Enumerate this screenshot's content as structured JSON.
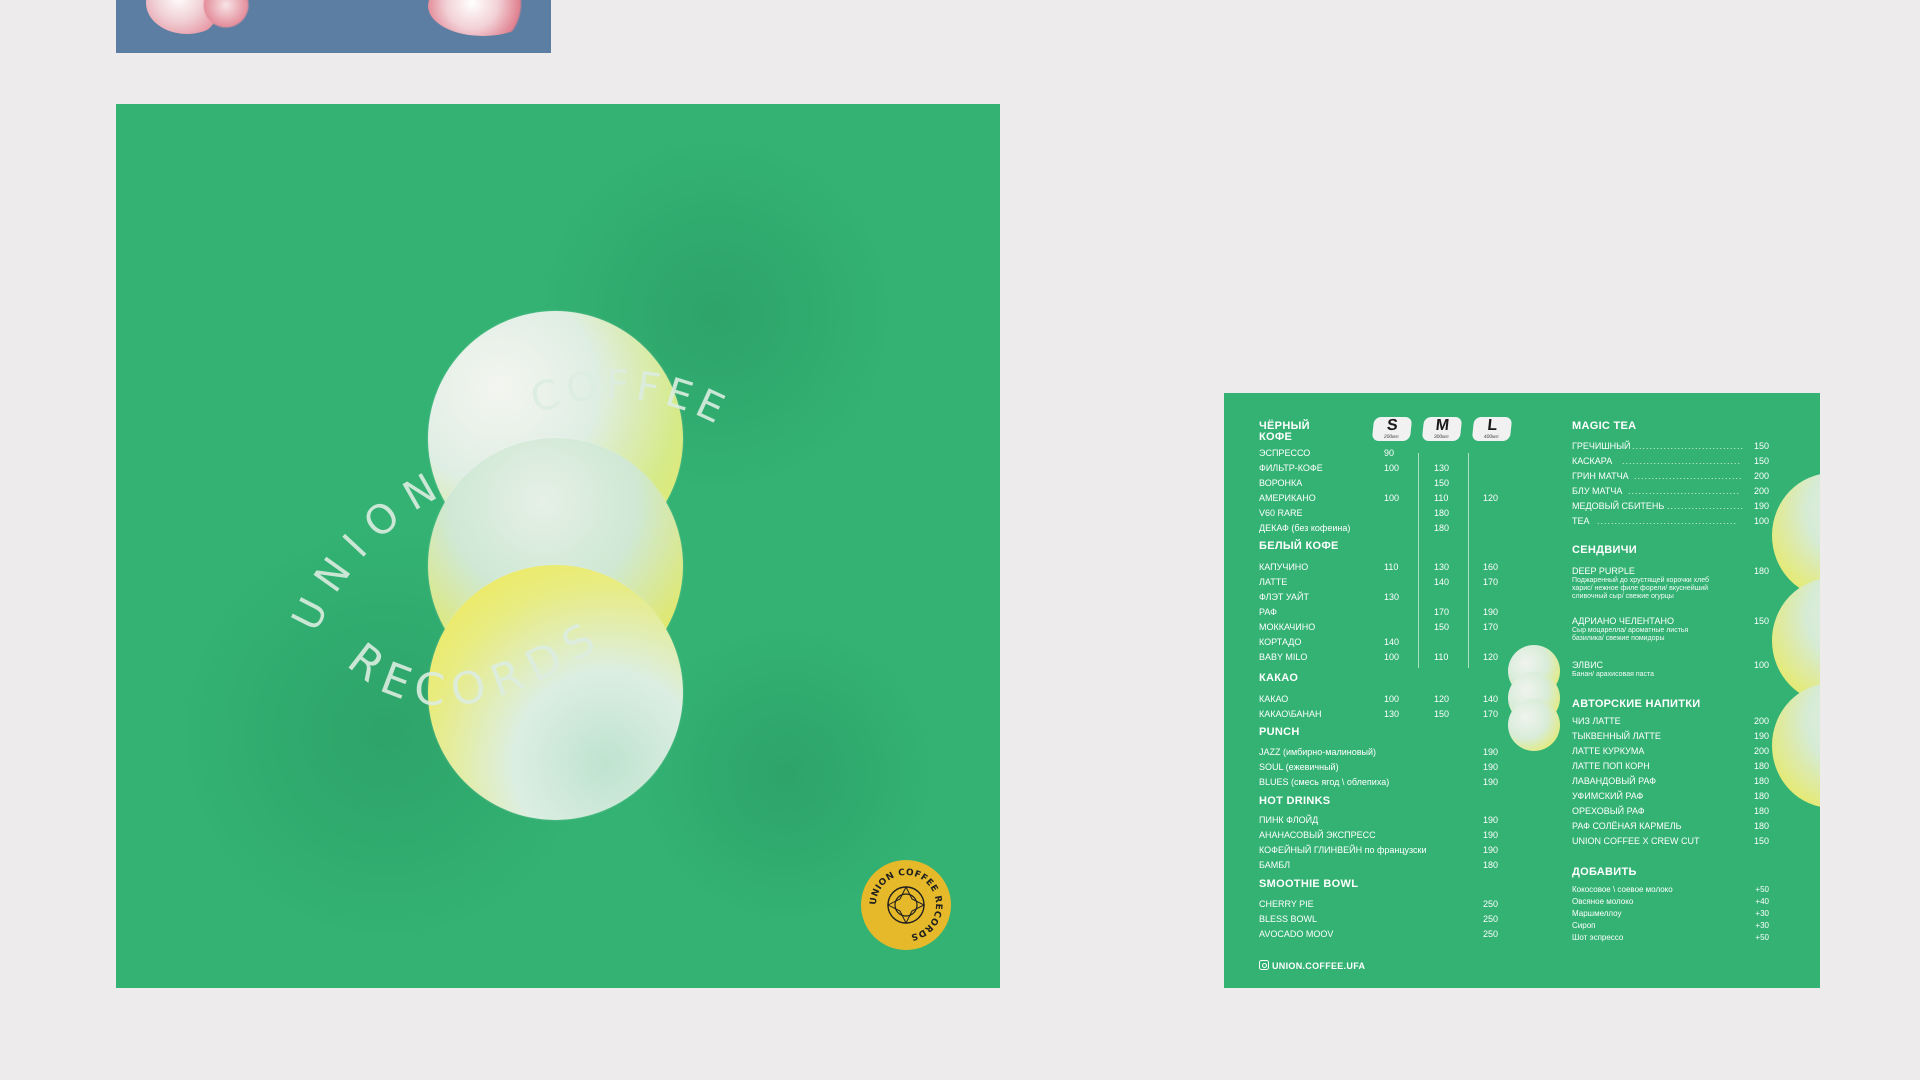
{
  "colors": {
    "page_background": "#edebec",
    "poster_green": "#33b273",
    "banner_blue": "#5b7ea2",
    "sphere_yellow": "#e9e64e",
    "sticker_gold": "#e5b92a"
  },
  "poster": {
    "ring_text_top": "COFFEE",
    "ring_text_left": "UNION",
    "ring_text_bottom": "RECORDS",
    "sticker_text": "UNION COFFEE RECORDS"
  },
  "menu": {
    "sizes": [
      {
        "label": "S",
        "volume": "200мл"
      },
      {
        "label": "M",
        "volume": "300мл"
      },
      {
        "label": "L",
        "volume": "400мл"
      }
    ],
    "black_coffee": {
      "title_line1": "ЧЁРНЫЙ",
      "title_line2": "КОФЕ",
      "items": [
        {
          "name": "ЭСПРЕССО",
          "s": "90",
          "m": "",
          "l": ""
        },
        {
          "name": "ФИЛЬТР-КОФЕ",
          "s": "100",
          "m": "130",
          "l": ""
        },
        {
          "name": "ВОРОНКА",
          "s": "",
          "m": "150",
          "l": ""
        },
        {
          "name": "АМЕРИКАНО",
          "s": "100",
          "m": "110",
          "l": "120"
        },
        {
          "name": "V60 RARE",
          "s": "",
          "m": "180",
          "l": ""
        },
        {
          "name": "ДЕКАФ (без кофеина)",
          "s": "",
          "m": "180",
          "l": ""
        }
      ]
    },
    "white_coffee": {
      "title": "БЕЛЫЙ КОФЕ",
      "items": [
        {
          "name": "КАПУЧИНО",
          "s": "110",
          "m": "130",
          "l": "160"
        },
        {
          "name": "ЛАТТЕ",
          "s": "",
          "m": "140",
          "l": "170"
        },
        {
          "name": "ФЛЭТ УАЙТ",
          "s": "130",
          "m": "",
          "l": ""
        },
        {
          "name": "РАФ",
          "s": "",
          "m": "170",
          "l": "190"
        },
        {
          "name": "МОККАЧИНО",
          "s": "",
          "m": "150",
          "l": "170"
        },
        {
          "name": "КОРТАДО",
          "s": "140",
          "m": "",
          "l": ""
        },
        {
          "name": "BABY MILO",
          "s": "100",
          "m": "110",
          "l": "120"
        }
      ]
    },
    "cocoa": {
      "title": "КАКАО",
      "items": [
        {
          "name": "КАКАО",
          "s": "100",
          "m": "120",
          "l": "140"
        },
        {
          "name": "КАКАО\\БАНАН",
          "s": "130",
          "m": "150",
          "l": "170"
        }
      ]
    },
    "punch": {
      "title": "PUNCH",
      "items": [
        {
          "name": "JAZZ (имбирно-малиновый)",
          "price": "190"
        },
        {
          "name": "SOUL (ежевичный)",
          "price": "190"
        },
        {
          "name": "BLUES (смесь ягод \\ облепиха)",
          "price": "190"
        }
      ]
    },
    "hot_drinks": {
      "title": "HOT DRINKS",
      "items": [
        {
          "name": "ПИНК ФЛОЙД",
          "price": "190"
        },
        {
          "name": "АНАНАСОВЫЙ ЭКСПРЕСС",
          "price": "190"
        },
        {
          "name": "КОФЕЙНЫЙ ГЛИНВЕЙН по французски",
          "price": "190"
        },
        {
          "name": "БАМБЛ",
          "price": "180"
        }
      ]
    },
    "smoothie_bowl": {
      "title": "SMOOTHIE BOWL",
      "items": [
        {
          "name": "CHERRY PIE",
          "price": "250"
        },
        {
          "name": "BLESS BOWL",
          "price": "250"
        },
        {
          "name": "AVOCADO MOOV",
          "price": "250"
        }
      ]
    },
    "magic_tea": {
      "title": "MAGIC TEA",
      "items": [
        {
          "name": "ГРЕЧИШНЫЙ",
          "price": "150"
        },
        {
          "name": "КАСКАРА",
          "price": "150"
        },
        {
          "name": "ГРИН МАТЧА",
          "price": "200"
        },
        {
          "name": "БЛУ МАТЧА",
          "price": "200"
        },
        {
          "name": "МЕДОВЫЙ СБИТЕНЬ",
          "price": "190"
        },
        {
          "name": "TEA",
          "price": "100"
        }
      ]
    },
    "sandwiches": {
      "title": "СЕНДВИЧИ",
      "items": [
        {
          "name": "DEEP PURPLE",
          "price": "180",
          "desc": "Поджаренный до хрустящей корочки хлеб харис/ нежное филе форели/ вкуснейший сливочный сыр/ свежие огурцы"
        },
        {
          "name": "АДРИАНО ЧЕЛЕНТАНО",
          "price": "150",
          "desc": "Сыр моцарелла/ ароматные листья базилика/ свежие помидоры"
        },
        {
          "name": "ЭЛВИС",
          "price": "100",
          "desc": "Банан/ арахисовая паста"
        }
      ]
    },
    "signature": {
      "title": "АВТОРСКИЕ НАПИТКИ",
      "items": [
        {
          "name": "ЧИЗ ЛАТТЕ",
          "price": "200"
        },
        {
          "name": "ТЫКВЕННЫЙ ЛАТТЕ",
          "price": "190"
        },
        {
          "name": "ЛАТТЕ КУРКУМА",
          "price": "200"
        },
        {
          "name": "ЛАТТЕ ПОП КОРН",
          "price": "180"
        },
        {
          "name": "ЛАВАНДОВЫЙ РАФ",
          "price": "180"
        },
        {
          "name": "УФИМСКИЙ РАФ",
          "price": "180"
        },
        {
          "name": "ОРЕХОВЫЙ РАФ",
          "price": "180"
        },
        {
          "name": "РАФ СОЛЁНАЯ КАРМЕЛЬ",
          "price": "180"
        },
        {
          "name": "UNION COFFEE X CREW CUT",
          "price": "150"
        }
      ]
    },
    "addons": {
      "title": "ДОБАВИТЬ",
      "items": [
        {
          "name": "Кокосовое \\ соевое молоко",
          "price": "+50"
        },
        {
          "name": "Овсяное молоко",
          "price": "+40"
        },
        {
          "name": "Маршмеллоу",
          "price": "+30"
        },
        {
          "name": "Сироп",
          "price": "+30"
        },
        {
          "name": "Шот эспрессо",
          "price": "+50"
        }
      ]
    },
    "instagram_handle": "UNION.COFFEE.UFA"
  }
}
